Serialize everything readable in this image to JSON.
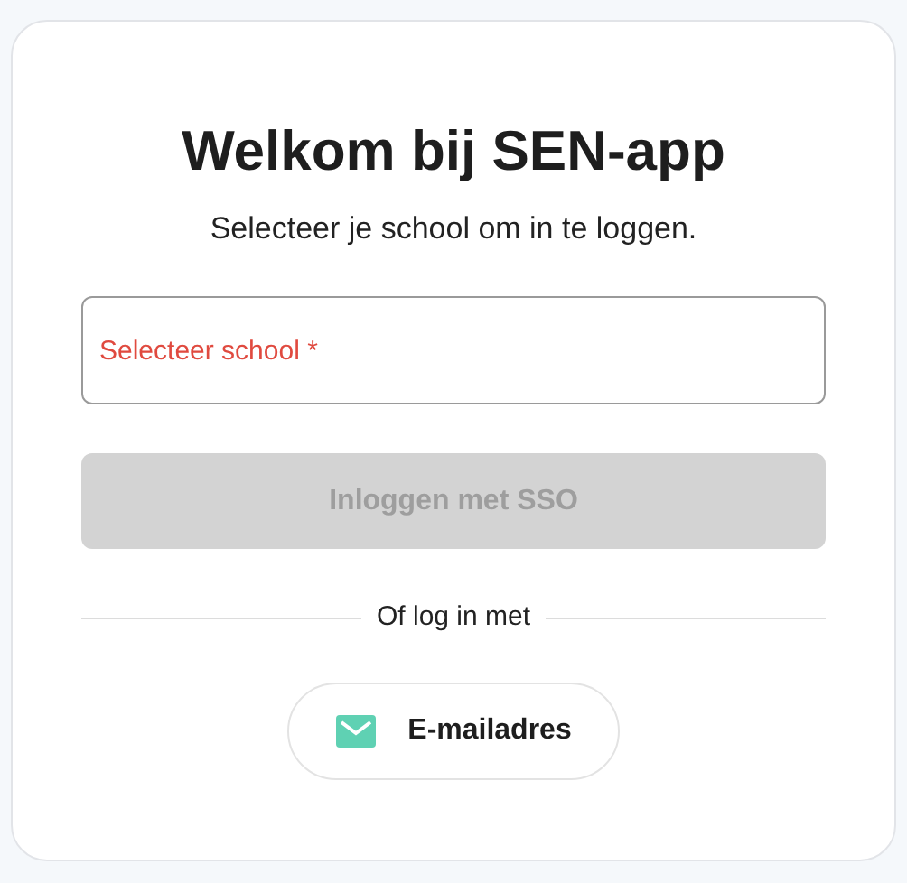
{
  "title": "Welkom bij SEN-app",
  "subtitle": "Selecteer je school om in te loggen.",
  "school_field": {
    "placeholder": "Selecteer school *",
    "required": true
  },
  "sso_button": {
    "label": "Inloggen met SSO",
    "disabled": true
  },
  "divider": {
    "label": "Of log in met"
  },
  "email_button": {
    "label": "E-mailadres"
  }
}
